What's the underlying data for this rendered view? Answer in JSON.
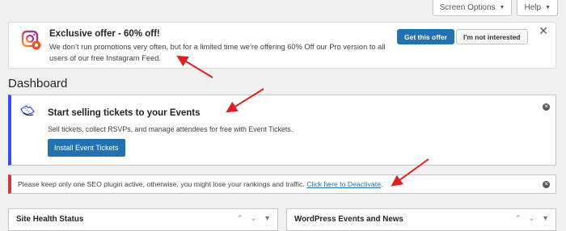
{
  "screen_meta": {
    "screen_options_label": "Screen Options",
    "help_label": "Help"
  },
  "promo": {
    "title": "Exclusive offer - 60% off!",
    "text": "We don’t run promotions very often, but for a limited time we’re offering 60% Off our Pro version to all users of our free Instagram Feed.",
    "get_offer_label": "Get this offer",
    "not_interested_label": "I'm not interested",
    "close_glyph": "✕",
    "logo_icon": "instagram-feed-logo-icon"
  },
  "page": {
    "title": "Dashboard"
  },
  "tickets_notice": {
    "title": "Start selling tickets to your Events",
    "text": "Sell tickets, collect RSVPs, and manage attendees for free with Event Tickets.",
    "install_label": "Install Event Tickets",
    "icon": "ticket-icon",
    "accent_color": "#334aff"
  },
  "seo_notice": {
    "text": "Please keep only one SEO plugin active, otherwise, you might lose your rankings and traffic.",
    "link_text": "Click here to Deactivate",
    "suffix": ".",
    "accent_color": "#d63638"
  },
  "widgets": [
    {
      "title": "Site Health Status"
    },
    {
      "title": "WordPress Events and News"
    }
  ],
  "colors": {
    "primary_button": "#2271b1",
    "annotation_arrow": "#e02020",
    "background": "#f0f0f1"
  }
}
